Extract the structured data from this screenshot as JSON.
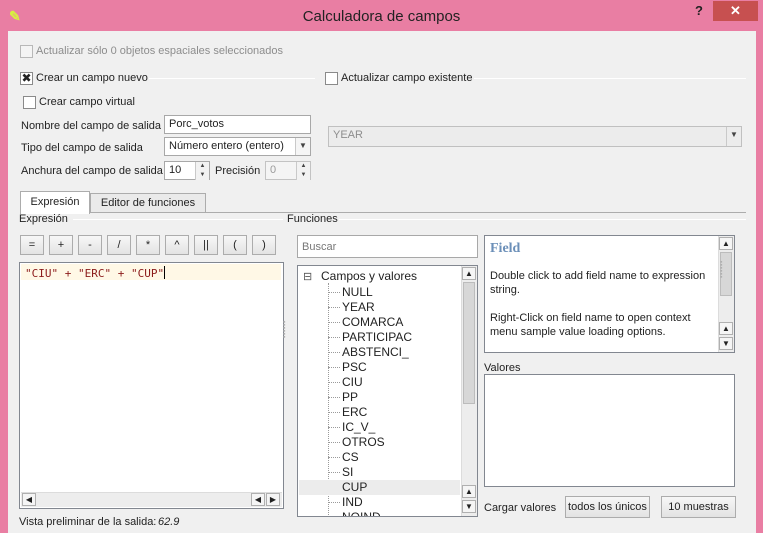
{
  "window": {
    "title": "Calculadora de campos",
    "help": "?",
    "close": "✕",
    "icon": "✎"
  },
  "options": {
    "update_selected": "Actualizar sólo 0 objetos espaciales seleccionados",
    "create_new": "Crear un campo nuevo",
    "create_new_checked": true,
    "update_existing": "Actualizar campo existente",
    "virtual_field": "Crear campo virtual"
  },
  "new_field": {
    "name_label": "Nombre del campo de salida",
    "name_value": "Porc_votos",
    "type_label": "Tipo del campo de salida",
    "type_value": "Número entero (entero)",
    "width_label": "Anchura del campo de salida",
    "width_value": "10",
    "precision_label": "Precisión",
    "precision_value": "0"
  },
  "existing_field": {
    "value": "YEAR"
  },
  "tabs": [
    {
      "label": "Expresión",
      "active": true
    },
    {
      "label": "Editor de funciones",
      "active": false
    }
  ],
  "expression": {
    "section_label": "Expresión",
    "operators": [
      "=",
      "+",
      "-",
      "/",
      "*",
      "^",
      "||",
      "(",
      ")"
    ],
    "text": "\"CIU\" + \"ERC\" + \"CUP\""
  },
  "functions": {
    "section_label": "Funciones",
    "search_placeholder": "Buscar",
    "group": "Campos y valores",
    "group_toggle": "⊟",
    "items": [
      "NULL",
      "YEAR",
      "COMARCA",
      "PARTICIPAC",
      "ABSTENCI_",
      "PSC",
      "CIU",
      "PP",
      "ERC",
      "IC_V_",
      "OTROS",
      "CS",
      "SI",
      "CUP",
      "IND",
      "NOIND"
    ],
    "selected": "CUP"
  },
  "help": {
    "title": "Field",
    "line1": "Double click to add field name to expression string.",
    "line2": "Right-Click on field name to open context menu sample value loading options."
  },
  "values": {
    "label": "Valores",
    "load_label": "Cargar valores",
    "all_unique": "todos los únicos",
    "sample": "10 muestras"
  },
  "preview": {
    "label": "Vista preliminar de la salida:",
    "value": "62.9"
  }
}
